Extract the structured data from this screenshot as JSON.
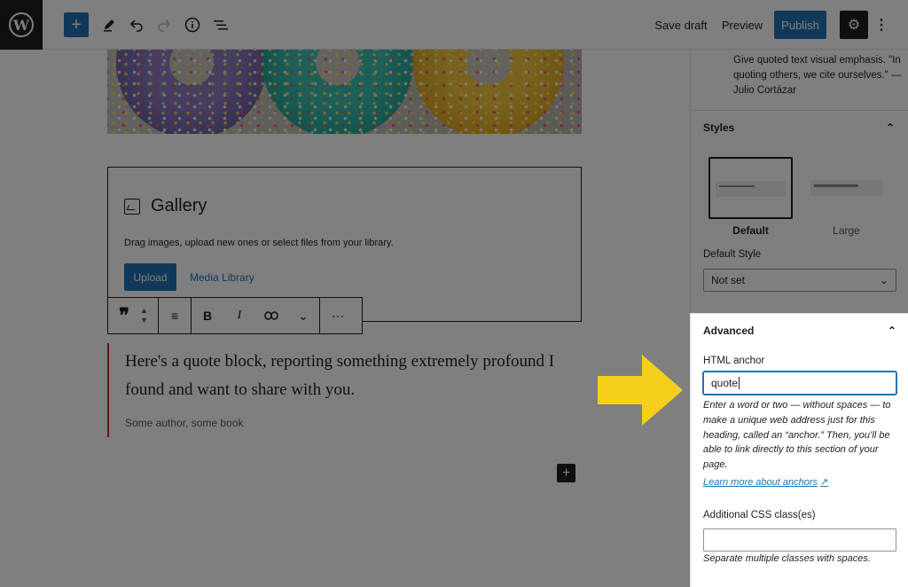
{
  "colors": {
    "accent": "#2271b1",
    "arrow": "#f5cf1c",
    "quote_border": "#c62828"
  },
  "topbar": {
    "logo_glyph": "W",
    "add_glyph": "+",
    "icons": [
      "edit-icon",
      "undo-icon",
      "redo-icon",
      "info-icon",
      "list-view-icon"
    ],
    "save_draft": "Save draft",
    "preview": "Preview",
    "publish": "Publish",
    "settings_glyph": "⚙",
    "more_glyph": "⋮"
  },
  "gallery": {
    "title": "Gallery",
    "description": "Drag images, upload new ones or select files from your library.",
    "upload": "Upload",
    "media_library": "Media Library"
  },
  "block_toolbar": {
    "quote_glyph": "❞",
    "align_glyph": "≡",
    "bold": "B",
    "italic": "I",
    "link_glyph": "⊂⊃",
    "more_glyph": "⌄",
    "options_glyph": "⋯"
  },
  "quote": {
    "text": "Here's a quote block, reporting something extremely profound I found and want to share with you.",
    "citation": "Some author, some book"
  },
  "canvas_add": "+",
  "sidebar": {
    "block_description": "Give quoted text visual emphasis. \"In quoting others, we cite ourselves.\" — Julio Cortázar",
    "styles": {
      "heading": "Styles",
      "options": [
        {
          "label": "Default",
          "selected": true
        },
        {
          "label": "Large",
          "selected": false
        }
      ],
      "default_style_label": "Default Style",
      "default_style_value": "Not set"
    },
    "advanced": {
      "heading": "Advanced",
      "anchor_label": "HTML anchor",
      "anchor_value": "quote",
      "anchor_help": "Enter a word or two — without spaces — to make a unique web address just for this heading, called an “anchor.” Then, you’ll be able to link directly to this section of your page.",
      "learn_more": "Learn more about anchors",
      "css_label": "Additional CSS class(es)",
      "css_value": "",
      "css_help": "Separate multiple classes with spaces."
    }
  }
}
